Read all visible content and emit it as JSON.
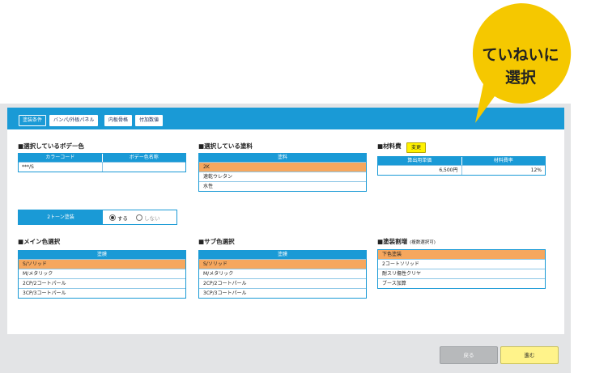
{
  "tabs": [
    "塗装条件",
    "バンパ/外板パネル",
    "内板骨格",
    "付加数値"
  ],
  "body_color": {
    "title": "■選択しているボデー色",
    "headers": [
      "カラーコード",
      "ボデー色名称"
    ],
    "rows": [
      [
        "***/S",
        ""
      ]
    ]
  },
  "paint": {
    "title": "■選択している塗料",
    "header": "塗料",
    "rows": [
      "2K",
      "速乾ウレタン",
      "水性"
    ]
  },
  "material": {
    "title": "■材料費",
    "change_label": "変更",
    "headers": [
      "算出用単価",
      "材料費率"
    ],
    "rows": [
      [
        "6,500円",
        "12%"
      ]
    ]
  },
  "two_tone": {
    "label": "2トーン塗装",
    "options": [
      "する",
      "しない"
    ]
  },
  "main_color": {
    "title": "■メイン色選択",
    "header": "塗膜",
    "rows": [
      "S/ソリッド",
      "M/メタリック",
      "2CP/2コートパール",
      "3CP/3コートパール"
    ]
  },
  "sub_color": {
    "title": "■サブ色選択",
    "header": "塗膜",
    "rows": [
      "S/ソリッド",
      "M/メタリック",
      "2CP/2コートパール",
      "3CP/3コートパール"
    ]
  },
  "surcharge": {
    "title": "■塗装割増",
    "note": "(複数選択可)",
    "rows": [
      "下色塗装",
      "2コートソリッド",
      "耐スリ傷性クリヤ",
      "ブース加算"
    ]
  },
  "buttons": {
    "back": "戻る",
    "next": "進む"
  },
  "callout": {
    "line1": "ていねいに",
    "line2": "選択"
  },
  "colors": {
    "accent": "#1a9ad6",
    "selected": "#f6a75e",
    "callout": "#f5c800"
  }
}
